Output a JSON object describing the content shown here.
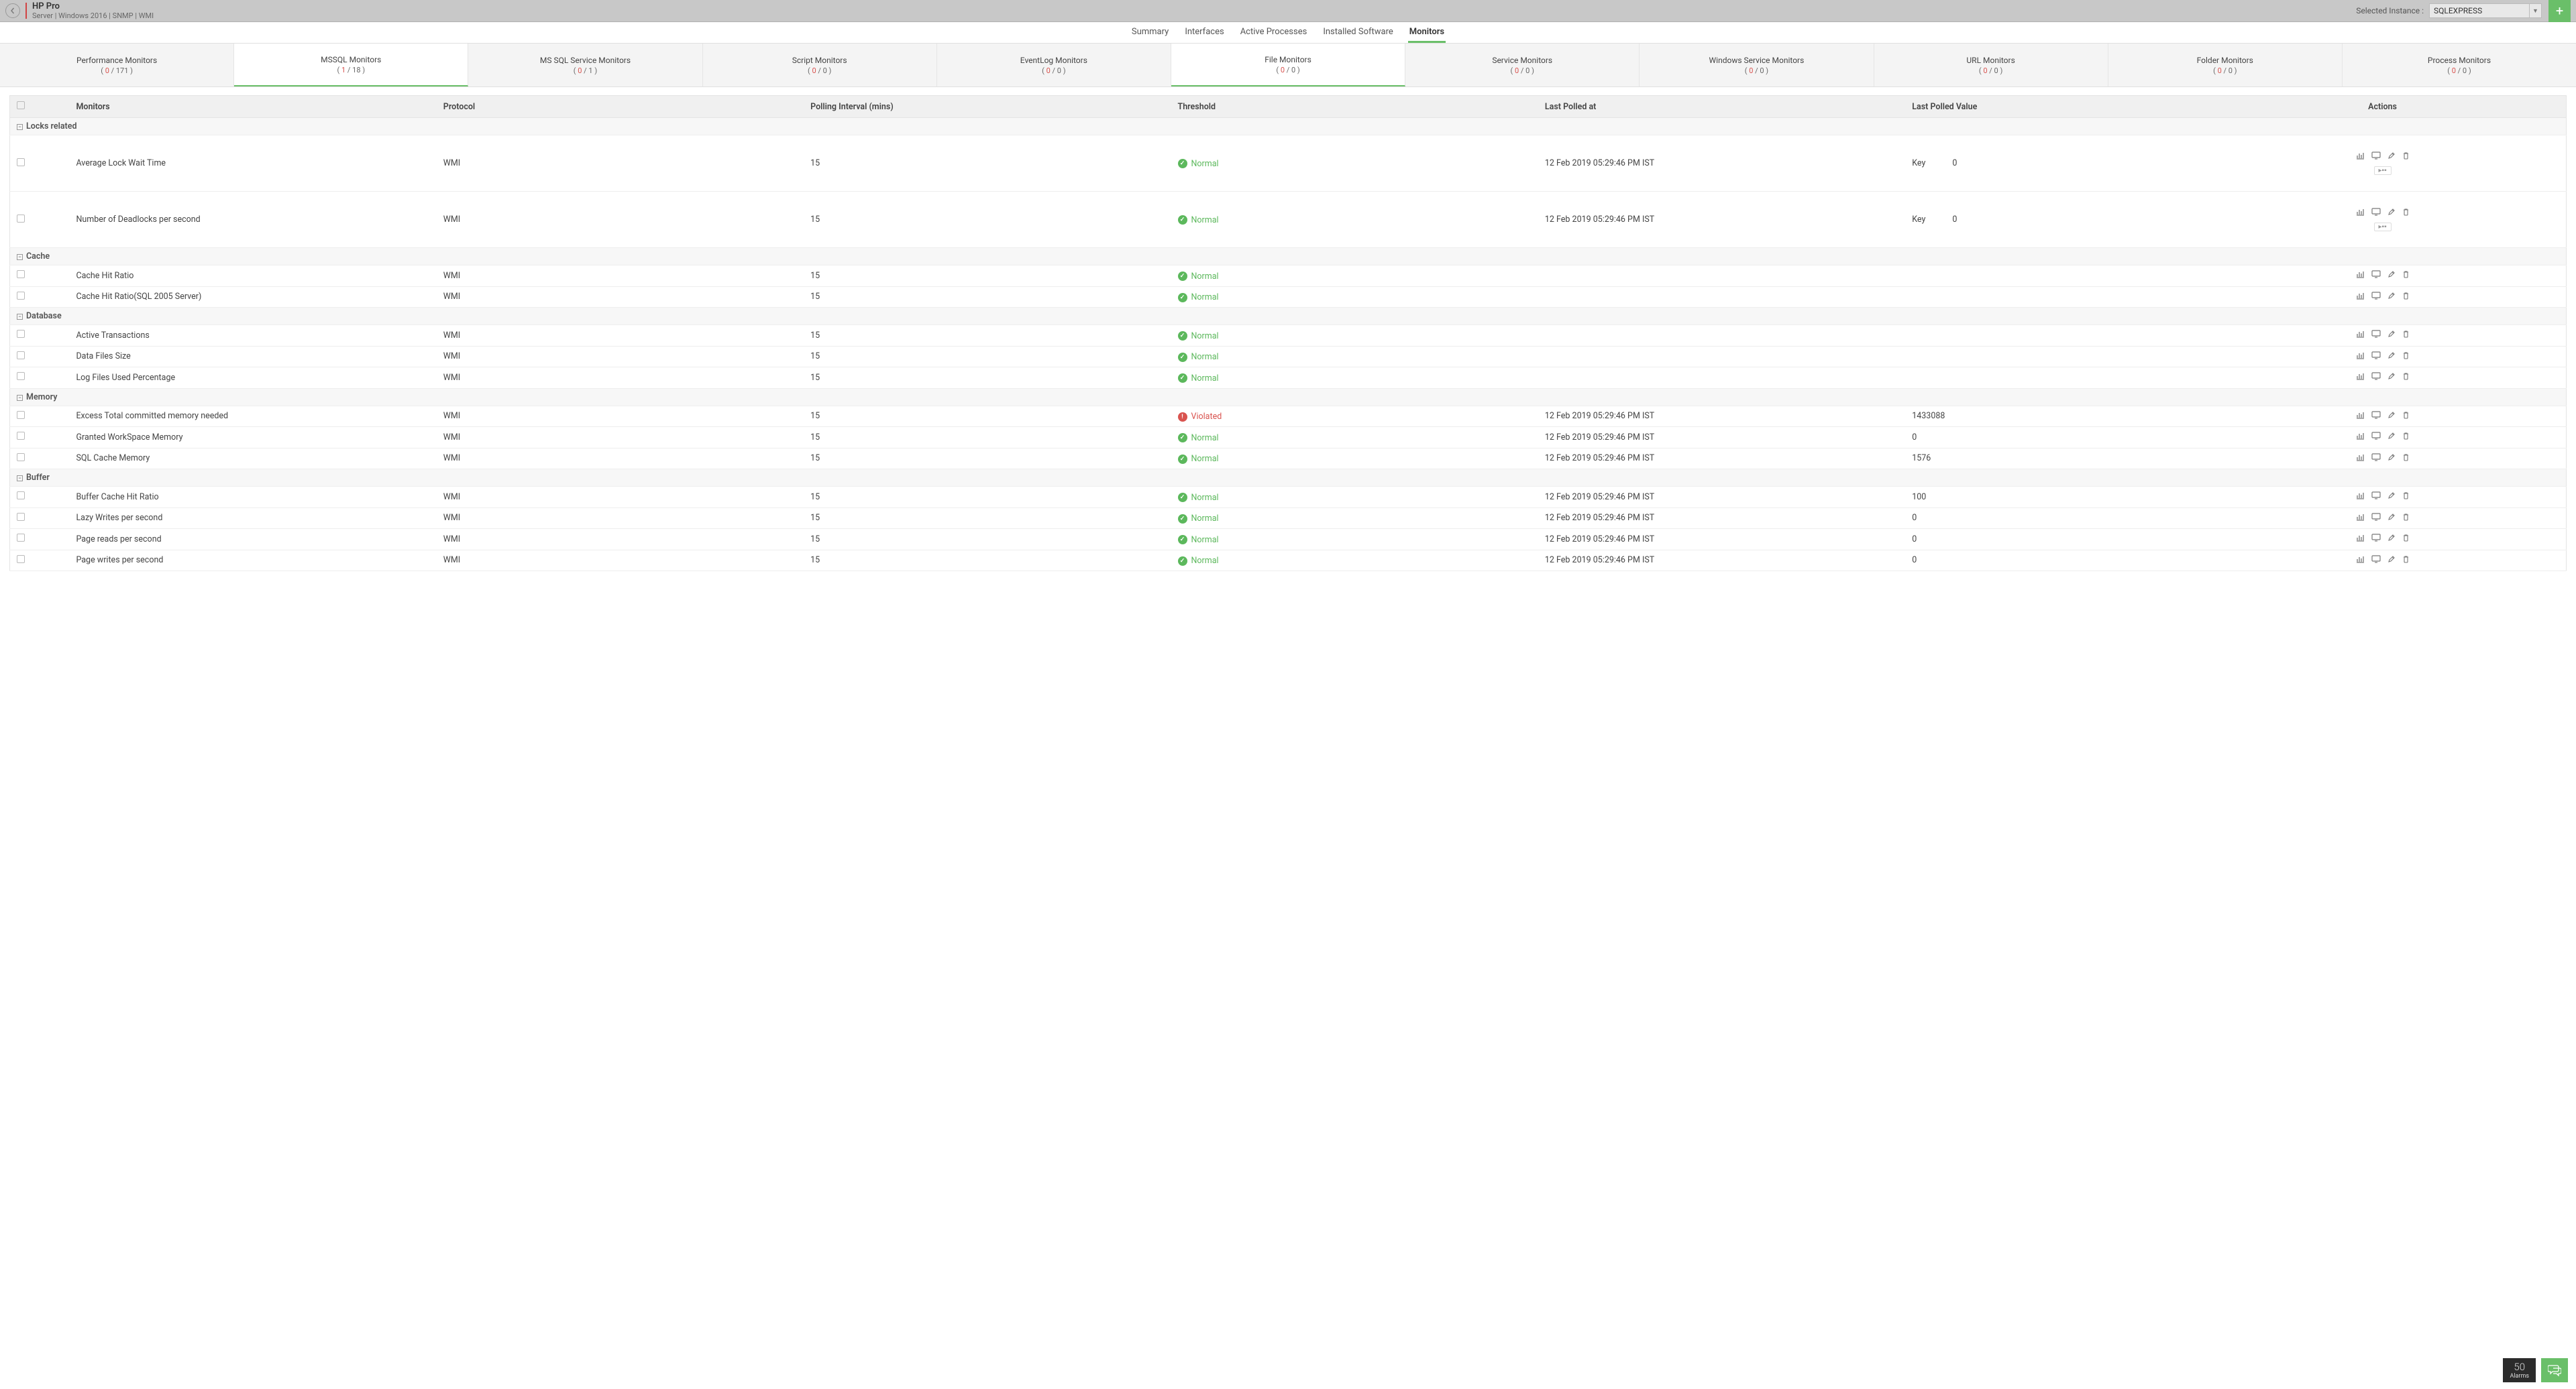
{
  "header": {
    "title": "HP Pro",
    "subtitle": "Server | Windows 2016  | SNMP  | WMI",
    "instance_label": "Selected Instance :",
    "instance_value": "SQLEXPRESS"
  },
  "main_tabs": [
    {
      "label": "Summary",
      "active": false
    },
    {
      "label": "Interfaces",
      "active": false
    },
    {
      "label": "Active Processes",
      "active": false
    },
    {
      "label": "Installed Software",
      "active": false
    },
    {
      "label": "Monitors",
      "active": true
    }
  ],
  "sub_tabs": [
    {
      "label": "Performance Monitors",
      "a": "0",
      "b": "171",
      "active": false
    },
    {
      "label": "MSSQL Monitors",
      "a": "1",
      "b": "18",
      "active": true
    },
    {
      "label": "MS SQL Service Monitors",
      "a": "0",
      "b": "1",
      "active": false
    },
    {
      "label": "Script Monitors",
      "a": "0",
      "b": "0",
      "active": false
    },
    {
      "label": "EventLog Monitors",
      "a": "0",
      "b": "0",
      "active": false
    },
    {
      "label": "File Monitors",
      "a": "0",
      "b": "0",
      "active": true
    },
    {
      "label": "Service Monitors",
      "a": "0",
      "b": "0",
      "active": false
    },
    {
      "label": "Windows Service Monitors",
      "a": "0",
      "b": "0",
      "active": false
    },
    {
      "label": "URL Monitors",
      "a": "0",
      "b": "0",
      "active": false
    },
    {
      "label": "Folder Monitors",
      "a": "0",
      "b": "0",
      "active": false
    },
    {
      "label": "Process Monitors",
      "a": "0",
      "b": "0",
      "active": false
    }
  ],
  "columns": {
    "monitors": "Monitors",
    "protocol": "Protocol",
    "poll": "Polling Interval (mins)",
    "threshold": "Threshold",
    "last_polled": "Last Polled at",
    "last_value": "Last Polled Value",
    "actions": "Actions"
  },
  "status": {
    "normal": "Normal",
    "violated": "Violated"
  },
  "kv": {
    "key": "Key",
    "zero": "0"
  },
  "expand": "▸▪▪",
  "groups": [
    {
      "name": "Locks related",
      "style": "tall",
      "rows": [
        {
          "name": "Average Lock Wait Time",
          "proto": "WMI",
          "poll": "15",
          "status": "normal",
          "lp": "12 Feb 2019 05:29:46 PM IST",
          "kv": true,
          "expand": true
        },
        {
          "name": "Number of Deadlocks per second",
          "proto": "WMI",
          "poll": "15",
          "status": "normal",
          "lp": "12 Feb 2019 05:29:46 PM IST",
          "kv": true,
          "expand": true
        }
      ]
    },
    {
      "name": "Cache",
      "rows": [
        {
          "name": "Cache Hit Ratio",
          "proto": "WMI",
          "poll": "15",
          "status": "normal",
          "lp": "",
          "lv": ""
        },
        {
          "name": "Cache Hit Ratio(SQL 2005 Server)",
          "proto": "WMI",
          "poll": "15",
          "status": "normal",
          "lp": "",
          "lv": ""
        }
      ]
    },
    {
      "name": "Database",
      "rows": [
        {
          "name": "Active Transactions",
          "proto": "WMI",
          "poll": "15",
          "status": "normal",
          "lp": "",
          "lv": ""
        },
        {
          "name": "Data Files Size",
          "proto": "WMI",
          "poll": "15",
          "status": "normal",
          "lp": "",
          "lv": ""
        },
        {
          "name": "Log Files Used Percentage",
          "proto": "WMI",
          "poll": "15",
          "status": "normal",
          "lp": "",
          "lv": ""
        }
      ]
    },
    {
      "name": "Memory",
      "rows": [
        {
          "name": "Excess Total committed memory needed",
          "proto": "WMI",
          "poll": "15",
          "status": "violated",
          "lp": "12 Feb 2019 05:29:46 PM IST",
          "lv": "1433088"
        },
        {
          "name": "Granted WorkSpace Memory",
          "proto": "WMI",
          "poll": "15",
          "status": "normal",
          "lp": "12 Feb 2019 05:29:46 PM IST",
          "lv": "0"
        },
        {
          "name": "SQL Cache Memory",
          "proto": "WMI",
          "poll": "15",
          "status": "normal",
          "lp": "12 Feb 2019 05:29:46 PM IST",
          "lv": "1576"
        }
      ]
    },
    {
      "name": "Buffer",
      "rows": [
        {
          "name": "Buffer Cache Hit Ratio",
          "proto": "WMI",
          "poll": "15",
          "status": "normal",
          "lp": "12 Feb 2019 05:29:46 PM IST",
          "lv": "100"
        },
        {
          "name": "Lazy Writes per second",
          "proto": "WMI",
          "poll": "15",
          "status": "normal",
          "lp": "12 Feb 2019 05:29:46 PM IST",
          "lv": "0"
        },
        {
          "name": "Page reads per second",
          "proto": "WMI",
          "poll": "15",
          "status": "normal",
          "lp": "12 Feb 2019 05:29:46 PM IST",
          "lv": "0"
        },
        {
          "name": "Page writes per second",
          "proto": "WMI",
          "poll": "15",
          "status": "normal",
          "lp": "12 Feb 2019 05:29:46 PM IST",
          "lv": "0"
        }
      ]
    }
  ],
  "alarms": {
    "count": "50",
    "label": "Alarms"
  }
}
